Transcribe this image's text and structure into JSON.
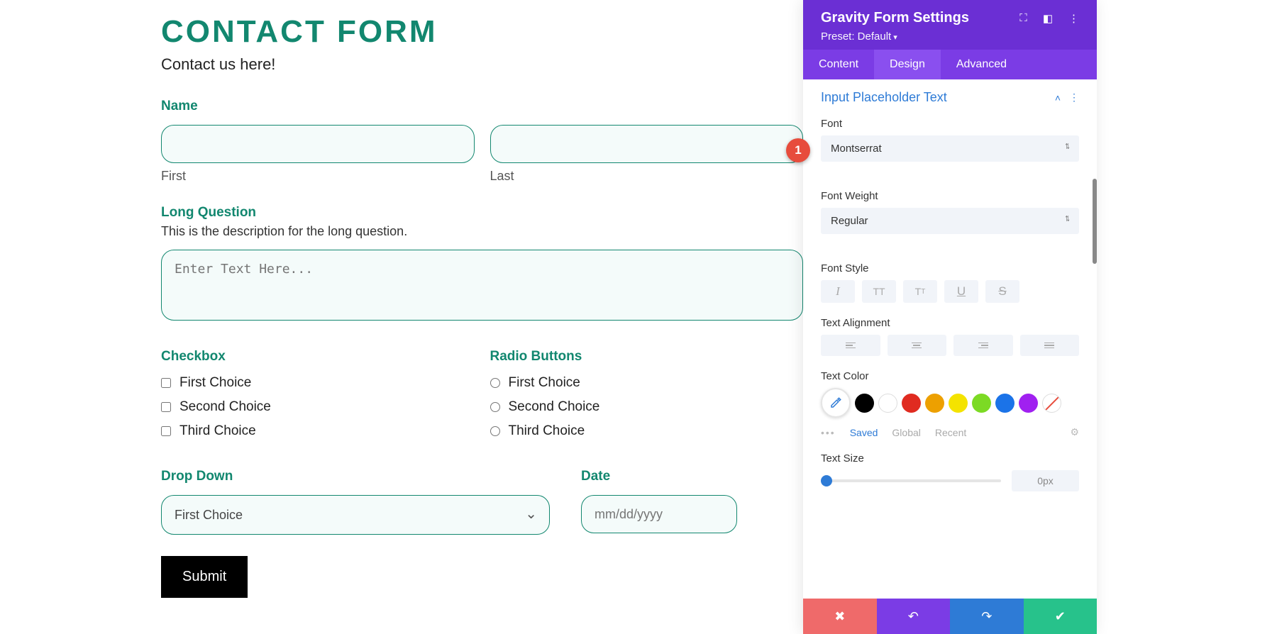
{
  "form": {
    "title": "CONTACT FORM",
    "subtitle": "Contact us here!",
    "name": {
      "label": "Name",
      "first_label": "First",
      "last_label": "Last"
    },
    "long_question": {
      "label": "Long Question",
      "description": "This is the description for the long question.",
      "placeholder": "Enter Text Here..."
    },
    "checkbox": {
      "label": "Checkbox",
      "options": [
        "First Choice",
        "Second Choice",
        "Third Choice"
      ]
    },
    "radio": {
      "label": "Radio Buttons",
      "options": [
        "First Choice",
        "Second Choice",
        "Third Choice"
      ]
    },
    "dropdown": {
      "label": "Drop Down",
      "value": "First Choice"
    },
    "date": {
      "label": "Date",
      "placeholder": "mm/dd/yyyy"
    },
    "submit_label": "Submit"
  },
  "panel": {
    "title": "Gravity Form Settings",
    "preset": "Preset: Default",
    "tabs": {
      "content": "Content",
      "design": "Design",
      "advanced": "Advanced"
    },
    "section_title": "Input Placeholder Text",
    "font_label": "Font",
    "font_value": "Montserrat",
    "weight_label": "Font Weight",
    "weight_value": "Regular",
    "style_label": "Font Style",
    "align_label": "Text Alignment",
    "color_label": "Text Color",
    "color_tabs": {
      "saved": "Saved",
      "global": "Global",
      "recent": "Recent"
    },
    "size_label": "Text Size",
    "size_value": "0px",
    "swatches": [
      "#000000",
      "#ffffff",
      "#e02b20",
      "#eda000",
      "#f4e300",
      "#7cda24",
      "#1b73e8",
      "#a020f0"
    ]
  },
  "marker": {
    "label": "1"
  }
}
